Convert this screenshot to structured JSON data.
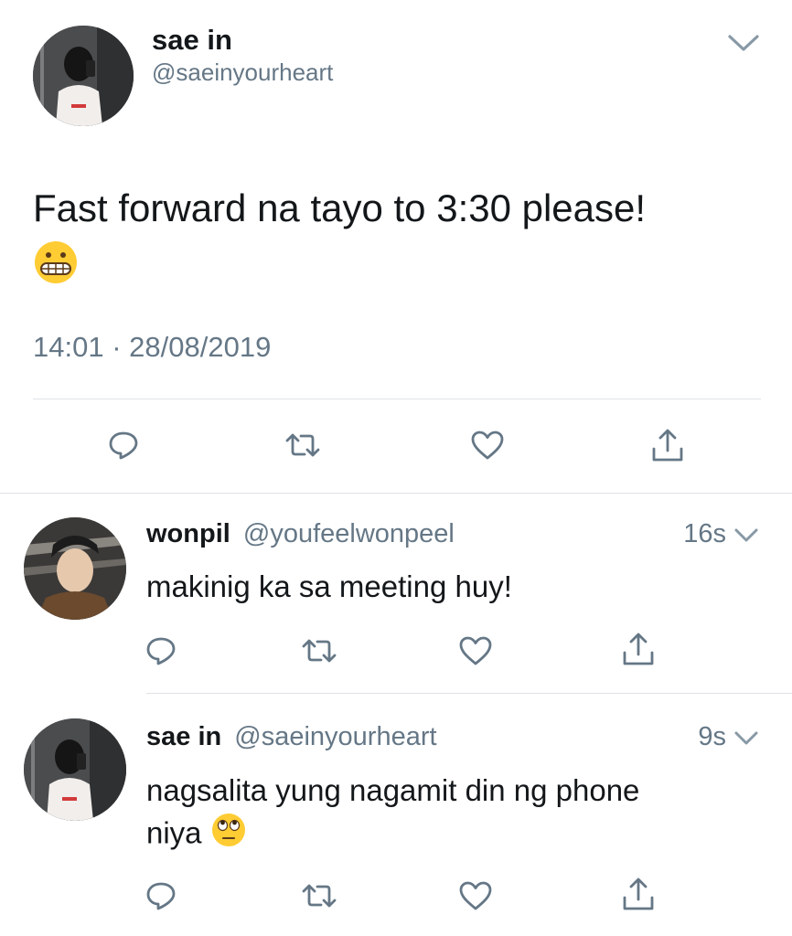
{
  "main_tweet": {
    "name": "sae in",
    "handle": "@saeinyourheart",
    "text": "Fast forward na tayo to 3:30 please!",
    "emoji": "grimacing-face",
    "time": "14:01",
    "separator": "·",
    "date": "28/08/2019"
  },
  "replies": [
    {
      "name": "wonpil",
      "handle": "@youfeelwonpeel",
      "time": "16s",
      "text": "makinig ka sa meeting huy!"
    },
    {
      "name": "sae in",
      "handle": "@saeinyourheart",
      "time": "9s",
      "text_line1": "nagsalita yung nagamit din ng phone",
      "text_line2": "niya",
      "emoji": "face-with-rolling-eyes"
    }
  ],
  "actions": [
    "reply-icon",
    "retweet-icon",
    "like-icon",
    "share-icon"
  ],
  "colors": {
    "text": "#14171a",
    "muted": "#657786",
    "divider": "#dfe3e6",
    "icon": "#657786"
  }
}
